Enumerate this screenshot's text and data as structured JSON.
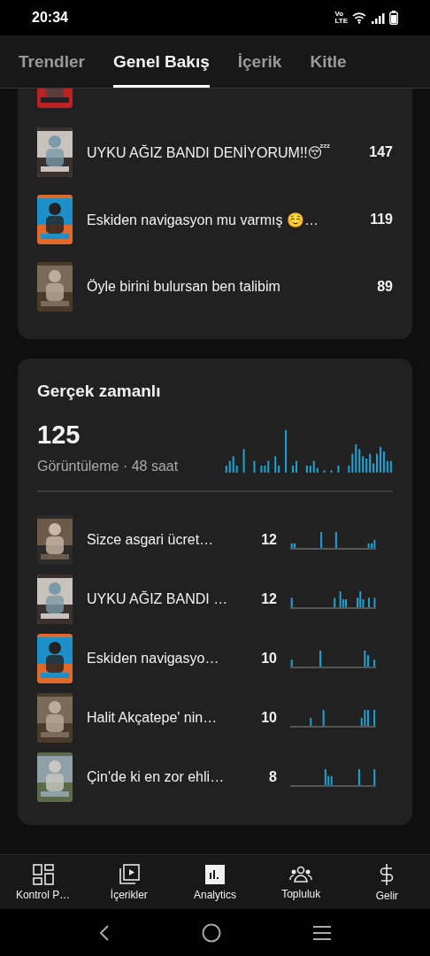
{
  "status_bar": {
    "time": "20:34",
    "volte": [
      "Vo",
      "LTE"
    ]
  },
  "tabs": [
    {
      "label": "Trendler",
      "selected": false
    },
    {
      "label": "Genel Bakış",
      "selected": true
    },
    {
      "label": "İçerik",
      "selected": false
    },
    {
      "label": "Kitle",
      "selected": false
    }
  ],
  "top_videos": [
    {
      "kind": "clipped"
    },
    {
      "kind": "row",
      "title": "UYKU AĞIZ BANDI DENİYORUM!!😴",
      "views": "147"
    },
    {
      "kind": "row",
      "title": "Eskiden navigasyon mu varmış ☺️…",
      "views": "119"
    },
    {
      "kind": "row",
      "title": "Öyle birini bulursan ben talibim",
      "views": "89"
    }
  ],
  "realtime": {
    "title": "Gerçek zamanlı",
    "total": "125",
    "subtitle": "Görüntüleme · 48 saat",
    "videos": [
      {
        "title": "Sizce asgari ücret…",
        "views": "12"
      },
      {
        "title": "UYKU AĞIZ BANDI …",
        "views": "12"
      },
      {
        "title": "Eskiden navigasyo…",
        "views": "10"
      },
      {
        "title": "Halit Akçatepe' nin…",
        "views": "10"
      },
      {
        "title": "Çin'de ki en zor ehli…",
        "views": "8"
      }
    ]
  },
  "bottom_nav": [
    {
      "kind": "dashboard",
      "label": "Kontrol P…",
      "selected": false
    },
    {
      "kind": "content",
      "label": "İçerikler",
      "selected": false
    },
    {
      "kind": "analytics",
      "label": "Analytics",
      "selected": true
    },
    {
      "kind": "community",
      "label": "Topluluk",
      "selected": false
    },
    {
      "kind": "earnings",
      "label": "Gelir",
      "selected": false
    }
  ]
}
